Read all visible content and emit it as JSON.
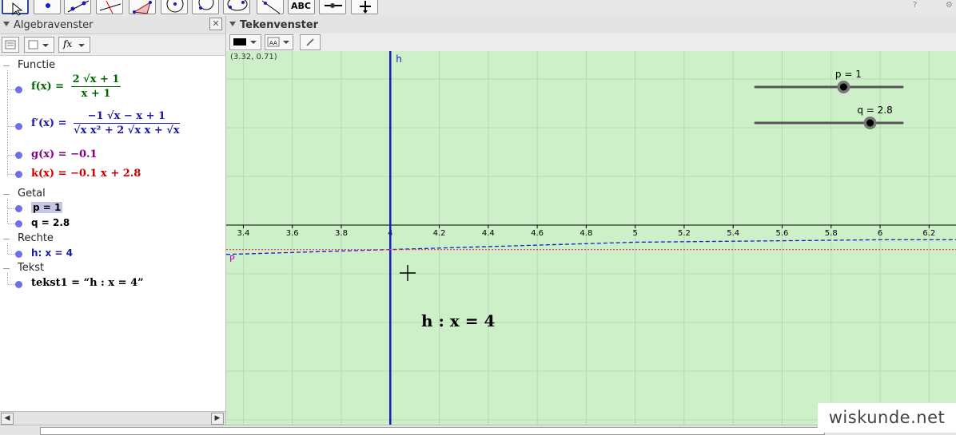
{
  "toolbar": {
    "tools": [
      "move-tool",
      "point-tool",
      "line-tool",
      "perpendicular-tool",
      "polygon-tool",
      "circle-tool",
      "arc-tool",
      "conic-tool",
      "angle-tool",
      "reflect-tool",
      "text-tool",
      "slider-tool",
      "move-view-tool"
    ],
    "text_tool_label": "ABC",
    "help_icon": "?",
    "settings_icon": "⚙"
  },
  "algebra": {
    "title": "Algebravenster",
    "close": "✕",
    "fx_label": "fx",
    "groups": {
      "functie": "Functie",
      "getal": "Getal",
      "rechte": "Rechte",
      "tekst": "Tekst"
    },
    "f": {
      "lhs": "f(x) =",
      "num": "2 √x + 1",
      "den": "x + 1",
      "color": "#006600"
    },
    "fprime": {
      "lhs": "f′(x) =",
      "num": "−1 √x − x + 1",
      "den": "√x x² + 2 √x x + √x",
      "color": "#1a1aa0"
    },
    "g": {
      "text": "g(x) = −0.1",
      "color": "#800080"
    },
    "k": {
      "text": "k(x) = −0.1 x + 2.8",
      "color": "#cc0000"
    },
    "p": "p = 1",
    "q": "q = 2.8",
    "h": "h: x = 4",
    "tekst1": "tekst1 = “h : x = 4”",
    "scroll_left": "◀",
    "scroll_right": "▶"
  },
  "graphics": {
    "title": "Tekenvenster",
    "coords": "(3.32, 0.71)",
    "line_label": "h",
    "text_object": "h : x = 4",
    "point_label": "P",
    "slider_p": {
      "label": "p = 1",
      "value": 1,
      "min": -5,
      "max": 5
    },
    "slider_q": {
      "label": "q = 2.8",
      "value": 2.8,
      "min": -5,
      "max": 5
    },
    "colors": {
      "background": "#cdf0c8",
      "line_h": "#1a1acc",
      "curve_f": "#1a1acc",
      "line_k": "#ff3366"
    }
  },
  "chart_data": {
    "type": "line",
    "x_ticks": [
      "3.4",
      "3.6",
      "3.8",
      "4",
      "4.2",
      "4.4",
      "4.6",
      "4.8",
      "5",
      "5.2",
      "5.4",
      "5.6",
      "5.8",
      "6",
      "6.2"
    ],
    "xlim": [
      3.33,
      6.31
    ],
    "grid": true,
    "series": [
      {
        "name": "h",
        "style": "vertical line",
        "x": 4
      },
      {
        "name": "f",
        "style": "dashed",
        "x": [
          3.33,
          4,
          5,
          6,
          6.31
        ],
        "y": [
          -0.12,
          -0.1,
          -0.07,
          -0.06,
          -0.06
        ]
      },
      {
        "name": "k",
        "style": "dotted",
        "x": [
          3.33,
          6.31
        ],
        "y": [
          -0.1,
          -0.1
        ]
      }
    ]
  },
  "watermark": "wiskunde.net"
}
